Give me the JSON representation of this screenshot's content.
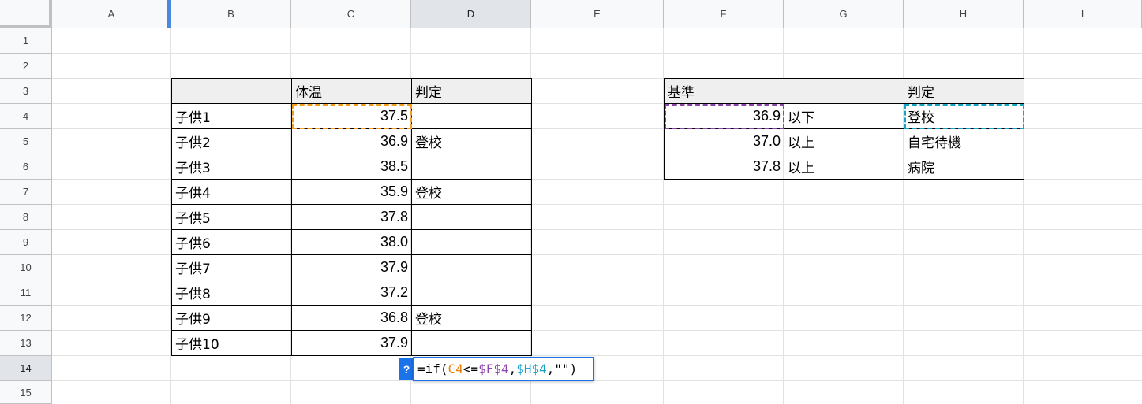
{
  "columns": [
    "A",
    "B",
    "C",
    "D",
    "E",
    "F",
    "G",
    "H",
    "I"
  ],
  "rows": [
    "1",
    "2",
    "3",
    "4",
    "5",
    "6",
    "7",
    "8",
    "9",
    "10",
    "11",
    "12",
    "13",
    "14",
    "15"
  ],
  "left_table": {
    "headers": [
      "",
      "体温",
      "判定"
    ],
    "rows": [
      {
        "name": "子供1",
        "temp": "37.5",
        "result": ""
      },
      {
        "name": "子供2",
        "temp": "36.9",
        "result": "登校"
      },
      {
        "name": "子供3",
        "temp": "38.5",
        "result": ""
      },
      {
        "name": "子供4",
        "temp": "35.9",
        "result": "登校"
      },
      {
        "name": "子供5",
        "temp": "37.8",
        "result": ""
      },
      {
        "name": "子供6",
        "temp": "38.0",
        "result": ""
      },
      {
        "name": "子供7",
        "temp": "37.9",
        "result": ""
      },
      {
        "name": "子供8",
        "temp": "37.2",
        "result": ""
      },
      {
        "name": "子供9",
        "temp": "36.8",
        "result": "登校"
      },
      {
        "name": "子供10",
        "temp": "37.9",
        "result": ""
      }
    ]
  },
  "right_table": {
    "header_criteria": "基準",
    "header_result": "判定",
    "rows": [
      {
        "value": "36.9",
        "cond": "以下",
        "result": "登校"
      },
      {
        "value": "37.0",
        "cond": "以上",
        "result": "自宅待機"
      },
      {
        "value": "37.8",
        "cond": "以上",
        "result": "病院"
      }
    ]
  },
  "formula": {
    "help": "?",
    "prefix": "=if(",
    "ref1": "C4",
    "op": "<=",
    "ref2": "$F$4",
    "comma1": ",",
    "ref3": "$H$4",
    "suffix": ",\"\")"
  },
  "colors": {
    "ref_orange": "#f59d1f",
    "ref_purple": "#8e44ad",
    "ref_teal": "#17a2c6",
    "accent": "#1a73e8"
  }
}
